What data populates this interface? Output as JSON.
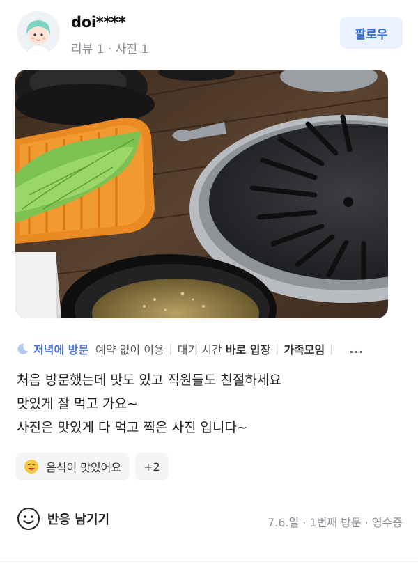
{
  "user": {
    "name": "doi****",
    "meta": "리뷰 1 · 사진 1",
    "follow_label": "팔로우"
  },
  "tags": {
    "visit": "저녁에 방문",
    "items": [
      {
        "prefix": "예약 없이 이용",
        "strong": ""
      },
      {
        "prefix": "대기 시간 ",
        "strong": "바로 입장"
      },
      {
        "prefix": "",
        "strong": "가족모임"
      }
    ],
    "more": "..."
  },
  "review": {
    "lines": [
      "처음 방문했는데 맛도 있고 직원들도 친절하세요",
      "맛있게 잘 먹고 가요~",
      "사진은 맛있게 다 먹고 찍은 사진 입니다~"
    ]
  },
  "chips": {
    "keyword": "음식이 맛있어요",
    "extra": "+2"
  },
  "footer": {
    "react_label": "반응 남기기",
    "visit_meta": "7.6.일 · 1번째 방문 · 영수증"
  },
  "colors": {
    "accent": "#2f6fe4",
    "follow_bg": "#eaf2ff",
    "visit_tag": "#4a73d9",
    "muted": "#8a8f96"
  },
  "icons": [
    "moon-icon",
    "smile-icon",
    "emoji-icon"
  ]
}
